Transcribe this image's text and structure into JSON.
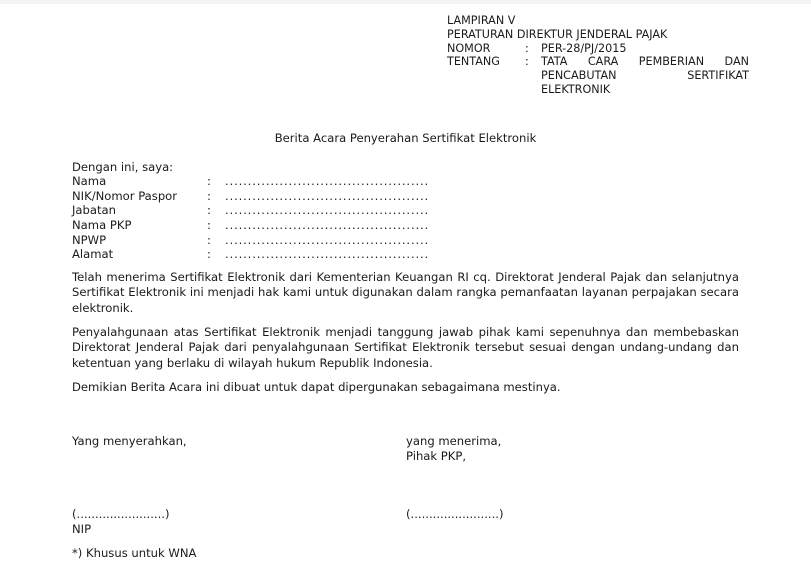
{
  "header": {
    "lampiran": "LAMPIRAN V",
    "peraturan": "PERATURAN DIREKTUR JENDERAL PAJAK",
    "nomor_label": "NOMOR",
    "nomor_colon": ":",
    "nomor_value": "PER-28/PJ/2015",
    "tentang_label": "TENTANG",
    "tentang_colon": ":",
    "tentang_line1": "TATA CARA PEMBERIAN DAN",
    "tentang_line2": "PENCABUTAN SERTIFIKAT",
    "tentang_line3": "ELEKTRONIK"
  },
  "title": "Berita Acara Penyerahan Sertifikat Elektronik",
  "form": {
    "intro": "Dengan ini, saya:",
    "colon": ":",
    "dots": ".............................................",
    "rows": [
      {
        "label": "Nama"
      },
      {
        "label": "NIK/Nomor Paspor"
      },
      {
        "label": "Jabatan"
      },
      {
        "label": "Nama PKP"
      },
      {
        "label": "NPWP"
      },
      {
        "label": "Alamat"
      }
    ]
  },
  "paragraphs": {
    "p1": "Telah menerima Sertifikat Elektronik dari Kementerian Keuangan RI cq. Direktorat Jenderal Pajak dan selanjutnya Sertifikat Elektronik ini menjadi hak kami untuk digunakan dalam rangka pemanfaatan layanan perpajakan secara elektronik.",
    "p2": "Penyalahgunaan atas Sertifikat Elektronik menjadi tanggung jawab pihak kami sepenuhnya dan membebaskan Direktorat Jenderal Pajak dari penyalahgunaan Sertifikat Elektronik tersebut sesuai dengan undang-undang dan ketentuan yang berlaku di wilayah hukum Republik Indonesia.",
    "p3": "Demikian Berita Acara ini dibuat untuk dapat dipergunakan sebagaimana mestinya."
  },
  "signature": {
    "left_heading": "Yang menyerahkan,",
    "right_heading_line1": "yang menerima,",
    "right_heading_line2": "Pihak PKP,",
    "left_name_placeholder": "(........................)",
    "left_nip": "NIP",
    "right_name_placeholder": "(........................)"
  },
  "footnote": "*) Khusus untuk WNA"
}
